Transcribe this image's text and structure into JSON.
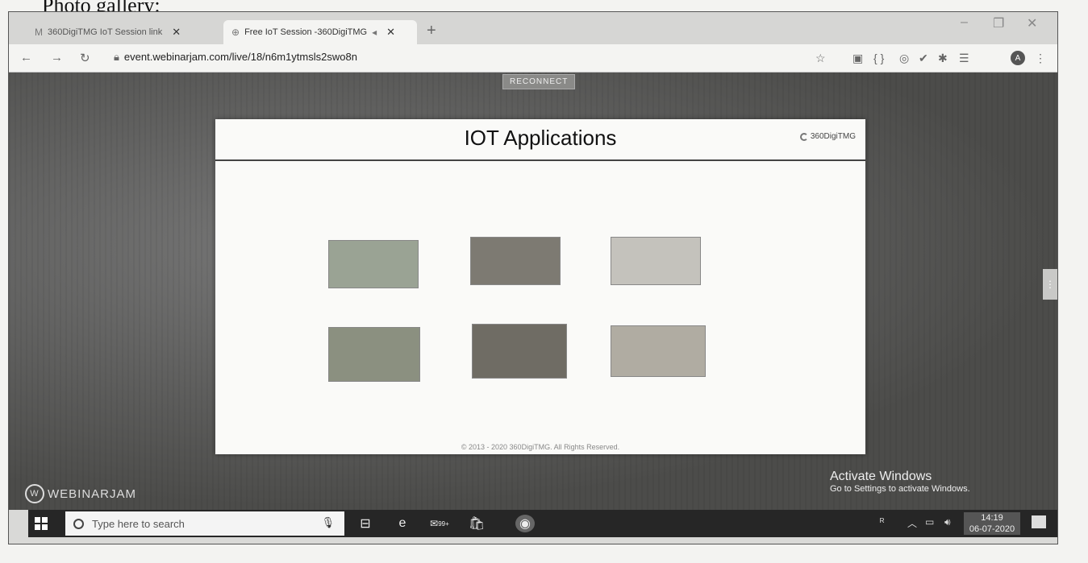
{
  "caption": "Photo gallery:",
  "browser": {
    "tabs": [
      {
        "label": "360DigiTMG IoT Session link",
        "icon": "gmail-icon",
        "active": false
      },
      {
        "label": "Free IoT Session -360DigiTMG",
        "icon": "webinarjam-icon",
        "active": true
      }
    ],
    "url": "event.webinarjam.com/live/18/n6m1ytmsls2swo8n",
    "avatar_letter": "A"
  },
  "webinar": {
    "reconnect_label": "RECONNECT",
    "slide": {
      "title": "IOT Applications",
      "logo": "360DigiTMG",
      "footer": "© 2013 - 2020 360DigiTMG. All Rights Reserved.",
      "thumbnails": [
        "smart-city-image",
        "smart-watch-image",
        "smart-home-image",
        "smart-farming-image",
        "industrial-iot-image",
        "healthcare-iot-image"
      ]
    },
    "watermark": "WEBINARJAM",
    "activate_title": "Activate Windows",
    "activate_subtitle": "Go to Settings to activate Windows."
  },
  "taskbar": {
    "search_placeholder": "Type here to search",
    "time": "14:19",
    "date": "06-07-2020",
    "store_badge": "99+"
  }
}
